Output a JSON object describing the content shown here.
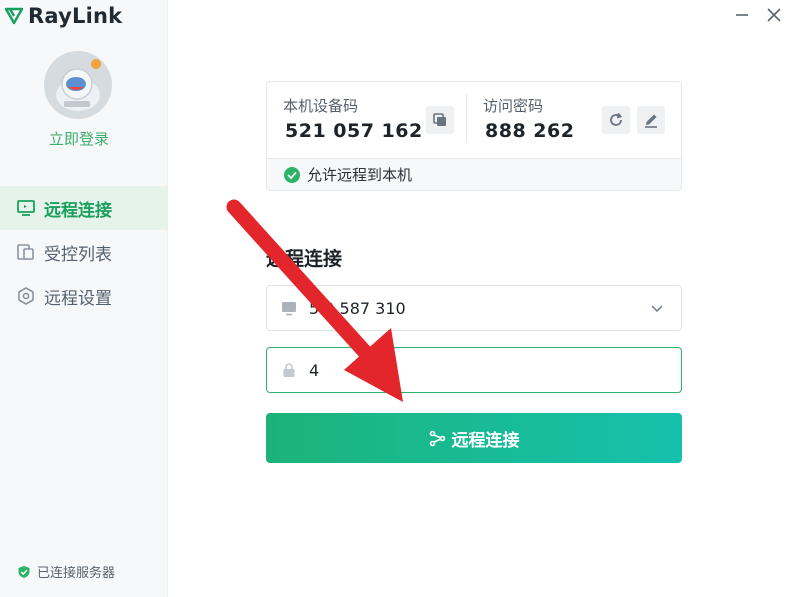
{
  "app": {
    "name": "RayLink"
  },
  "sidebar": {
    "login_label": "立即登录",
    "items": [
      {
        "label": "远程连接",
        "icon": "monitor-icon",
        "active": true
      },
      {
        "label": "受控列表",
        "icon": "devices-icon",
        "active": false
      },
      {
        "label": "远程设置",
        "icon": "settings-hex-icon",
        "active": false
      }
    ],
    "server_status": "已连接服务器"
  },
  "device_card": {
    "device_code_label": "本机设备码",
    "device_code_value": "521 057 162",
    "password_label": "访问密码",
    "password_value": "888 262",
    "allow_remote_label": "允许远程到本机"
  },
  "remote_connect": {
    "title": "远程连接",
    "device_id_value": "5 0 587 310",
    "password_value": "4",
    "button_label": "远程连接"
  },
  "colors": {
    "brand_green": "#19a05e",
    "button_gradient_start": "#1cb37a",
    "button_gradient_end": "#16c1ad",
    "annotation_red": "#e3262c"
  }
}
